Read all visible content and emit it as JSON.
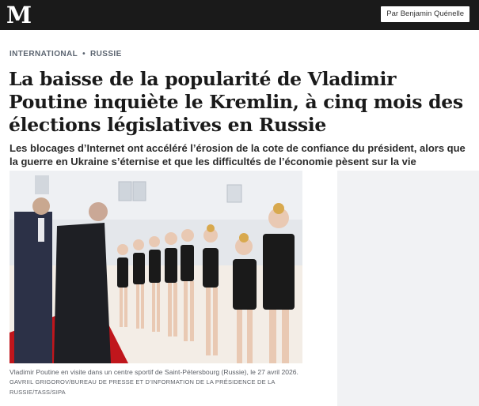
{
  "header": {
    "logo_letter": "M",
    "byline_button": "Par Benjamin Quénelle"
  },
  "breadcrumb": {
    "section": "INTERNATIONAL",
    "separator": "•",
    "subsection": "RUSSIE"
  },
  "article": {
    "title": "La baisse de la popularité de Vladimir Poutine inquiète le Kremlin, à cinq mois des élections législatives en Russie",
    "standfirst": "Les blocages d’Internet ont accéléré l’érosion de la cote de confiance du président, alors que la guerre en Ukraine s’éternise et que les difficultés de l’économie pèsent sur la vie quotidienne.",
    "caption": "Vladimir Poutine en visite dans un centre sportif de Saint-Pétersbourg (Russie), le 27 avril 2026.",
    "credit": "GAVRIIL GRIGOROV/BUREAU DE PRESSE ET D’INFORMATION DE LA PRÉSIDENCE DE LA RUSSIE/TASS/SIPA"
  },
  "colors": {
    "topbar": "#1a1a1a",
    "kicker": "#5b6470",
    "red_carpet": "#c0161c"
  }
}
